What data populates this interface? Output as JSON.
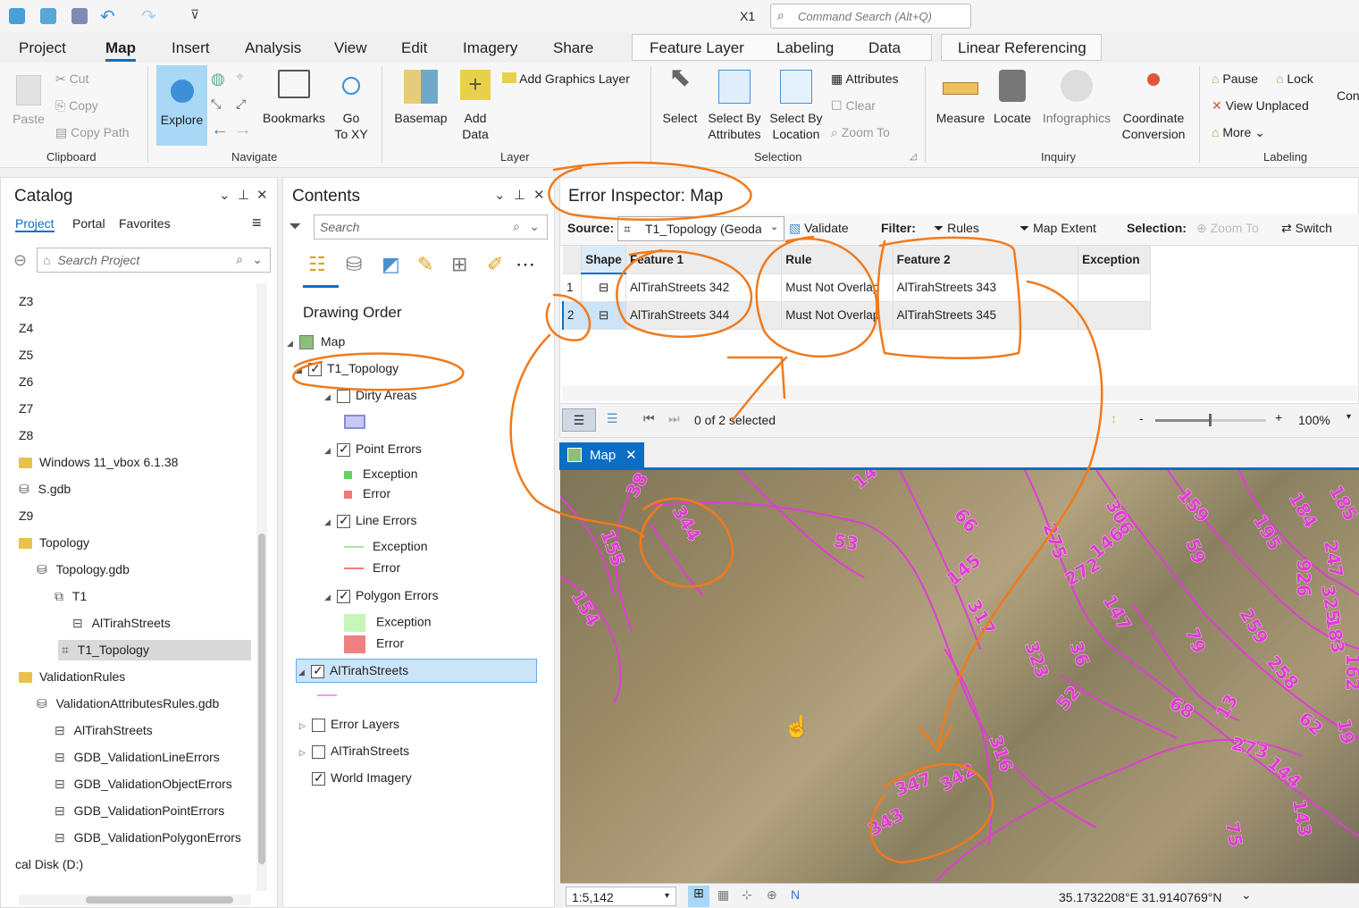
{
  "quick_access": {
    "title_text": "X1",
    "command_search_placeholder": "Command Search (Alt+Q)",
    "icons": [
      "new-project-icon",
      "open-project-icon",
      "save-project-icon",
      "undo-icon",
      "redo-icon",
      "customize-icon"
    ]
  },
  "ribbon_tabs": [
    "Project",
    "Map",
    "Insert",
    "Analysis",
    "View",
    "Edit",
    "Imagery",
    "Share"
  ],
  "active_tab": "Map",
  "contextual_tabs": {
    "feature_layer": [
      "Feature Layer",
      "Labeling",
      "Data"
    ],
    "linear_referencing": "Linear Referencing"
  },
  "ribbon": {
    "clipboard": {
      "label": "Clipboard",
      "paste": "Paste",
      "cut": "Cut",
      "copy": "Copy",
      "copy_path": "Copy Path"
    },
    "navigate": {
      "label": "Navigate",
      "explore": "Explore",
      "bookmarks": "Bookmarks",
      "go_to_xy": "Go\nTo XY",
      "go": "Go",
      "to_xy": "To XY"
    },
    "layer": {
      "label": "Layer",
      "basemap": "Basemap",
      "add_data": "Add",
      "add_data2": "Data",
      "add_graphics_layer": "Add Graphics Layer"
    },
    "selection": {
      "label": "Selection",
      "select": "Select",
      "select_by_attributes1": "Select By",
      "select_by_attributes2": "Attributes",
      "select_by_location1": "Select By",
      "select_by_location2": "Location",
      "attributes": "Attributes",
      "clear": "Clear",
      "zoom_to": "Zoom To"
    },
    "inquiry": {
      "label": "Inquiry",
      "measure": "Measure",
      "locate": "Locate",
      "infographics": "Infographics",
      "coordinate1": "Coordinate",
      "coordinate2": "Conversion"
    },
    "labeling": {
      "label": "Labeling",
      "pause": "Pause",
      "lock": "Lock",
      "view_unplaced": "View Unplaced",
      "more": "More",
      "conv": "Conv"
    }
  },
  "catalog": {
    "title": "Catalog",
    "tabs": [
      "Project",
      "Portal",
      "Favorites"
    ],
    "search_placeholder": "Search Project",
    "items": [
      "Z3",
      "Z4",
      "Z5",
      "Z6",
      "Z7",
      "Z8",
      "Windows 11_vbox 6.1.38",
      "S.gdb",
      "Z9",
      "Topology",
      "Topology.gdb",
      "T1",
      "AlTirahStreets",
      "T1_Topology",
      "ValidationRules",
      "ValidationAttributesRules.gdb",
      "AlTirahStreets",
      "GDB_ValidationLineErrors",
      "GDB_ValidationObjectErrors",
      "GDB_ValidationPointErrors",
      "GDB_ValidationPolygonErrors",
      "cal Disk (D:)"
    ]
  },
  "contents": {
    "title": "Contents",
    "search_placeholder": "Search",
    "drawing_order": "Drawing Order",
    "layers": {
      "map": "Map",
      "topology": "T1_Topology",
      "dirty_areas": "Dirty Areas",
      "point_errors": "Point Errors",
      "line_errors": "Line Errors",
      "polygon_errors": "Polygon Errors",
      "exception": "Exception",
      "error": "Error",
      "altirah": "AlTirahStreets",
      "error_layers": "Error Layers",
      "altirah2": "AlTirahStreets",
      "world_imagery": "World Imagery"
    }
  },
  "error_inspector": {
    "title": "Error Inspector: Map",
    "source_label": "Source:",
    "source_value": "T1_Topology (Geoda",
    "validate": "Validate",
    "filter_label": "Filter:",
    "rules": "Rules",
    "map_extent": "Map Extent",
    "selection_label": "Selection:",
    "zoom_to": "Zoom To",
    "switch": "Switch",
    "columns": [
      "Shape",
      "Feature 1",
      "Rule",
      "Feature 2",
      "Exception"
    ],
    "rows": [
      {
        "num": "1",
        "feature1": "AlTirahStreets 342",
        "rule": "Must Not Overlap",
        "feature2": "AlTirahStreets 343",
        "exception": ""
      },
      {
        "num": "2",
        "feature1": "AlTirahStreets 344",
        "rule": "Must Not Overlap",
        "feature2": "AlTirahStreets 345",
        "exception": ""
      }
    ],
    "selected_text": "0 of 2 selected",
    "zoom_level": "100%"
  },
  "map_view": {
    "tab_label": "Map",
    "labels": [
      "38",
      "344",
      "14",
      "66",
      "306",
      "159",
      "184",
      "185",
      "195",
      "155",
      "53",
      "275",
      "59",
      "926",
      "247",
      "325",
      "183",
      "162",
      "154",
      "145",
      "317",
      "272",
      "146",
      "147",
      "259",
      "79",
      "323",
      "36",
      "258",
      "52",
      "68",
      "13",
      "62",
      "19",
      "316",
      "273",
      "144",
      "143",
      "75",
      "347",
      "342",
      "343"
    ],
    "scale": "1:5,142",
    "coordinates": "35.1732208°E 31.9140769°N"
  },
  "colors": {
    "accent": "#0b6ec5",
    "street_line": "#e13cd6",
    "annotation": "#f07a1c",
    "selected_row": "#cce4f7"
  }
}
